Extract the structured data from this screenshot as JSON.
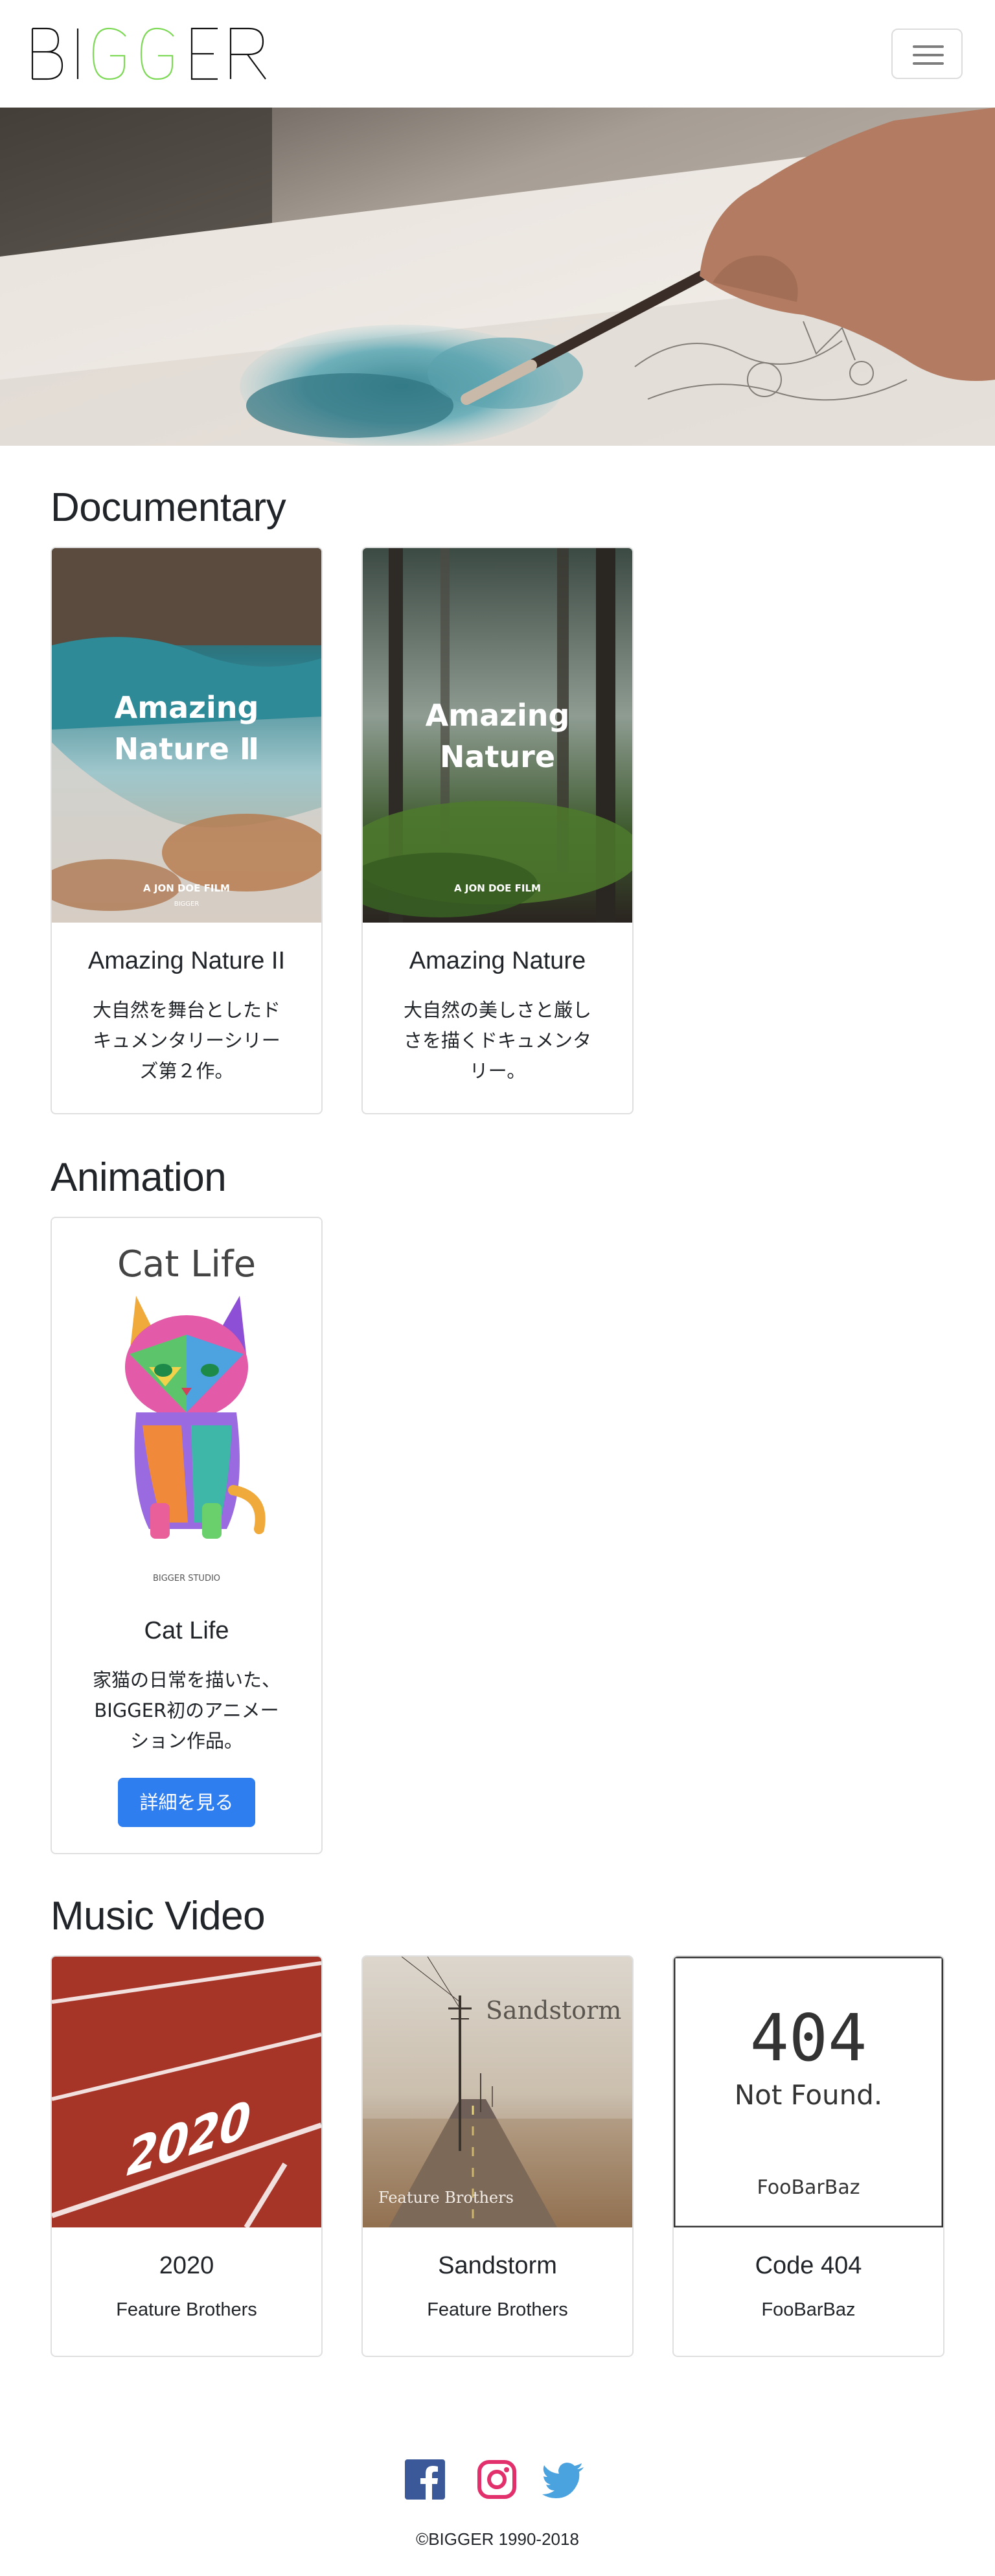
{
  "brand": {
    "logo_text": "BIGGER",
    "colors": {
      "accent_green": "#7ed957",
      "primary_blue": "#2f7ef0",
      "facebook": "#3b5998",
      "instagram": "#e1306c",
      "twitter": "#4aa3df"
    }
  },
  "navbar": {
    "menu_icon": "hamburger-icon"
  },
  "hero": {
    "image": "watercolor-painting-hero"
  },
  "sections": {
    "documentary": {
      "title": "Documentary",
      "cards": [
        {
          "poster_title_line1": "Amazing",
          "poster_title_line2": "Nature Ⅱ",
          "poster_credit": "A JON DOE FILM",
          "poster_studio": "BIGGER",
          "title": "Amazing Nature II",
          "text_lines": [
            "大自然を舞台としたド",
            "キュメンタリーシリー",
            "ズ第２作。"
          ]
        },
        {
          "poster_title_line1": "Amazing",
          "poster_title_line2": "Nature",
          "poster_credit": "A JON DOE FILM",
          "title": "Amazing Nature",
          "text_lines": [
            "大自然の美しさと厳し",
            "さを描くドキュメンタ",
            "リー。"
          ]
        }
      ]
    },
    "animation": {
      "title": "Animation",
      "cards": [
        {
          "poster_title": "Cat Life",
          "poster_studio": "BIGGER STUDIO",
          "title": "Cat Life",
          "text_lines": [
            "家猫の日常を描いた、",
            "BIGGER初のアニメー",
            "ション作品。"
          ],
          "button_label": "詳細を見る"
        }
      ]
    },
    "music_video": {
      "title": "Music Video",
      "cards": [
        {
          "poster_title": "2020",
          "title": "2020",
          "subtitle": "Feature Brothers"
        },
        {
          "poster_title": "Sandstorm",
          "poster_credit": "Feature Brothers",
          "title": "Sandstorm",
          "subtitle": "Feature Brothers"
        },
        {
          "poster_title_line1": "404",
          "poster_title_line2": "Not Found.",
          "poster_credit": "FooBarBaz",
          "title": "Code 404",
          "subtitle": "FooBarBaz"
        }
      ]
    }
  },
  "footer": {
    "icons": [
      "facebook-icon",
      "instagram-icon",
      "twitter-icon"
    ],
    "copyright": "©BIGGER 1990-2018"
  }
}
